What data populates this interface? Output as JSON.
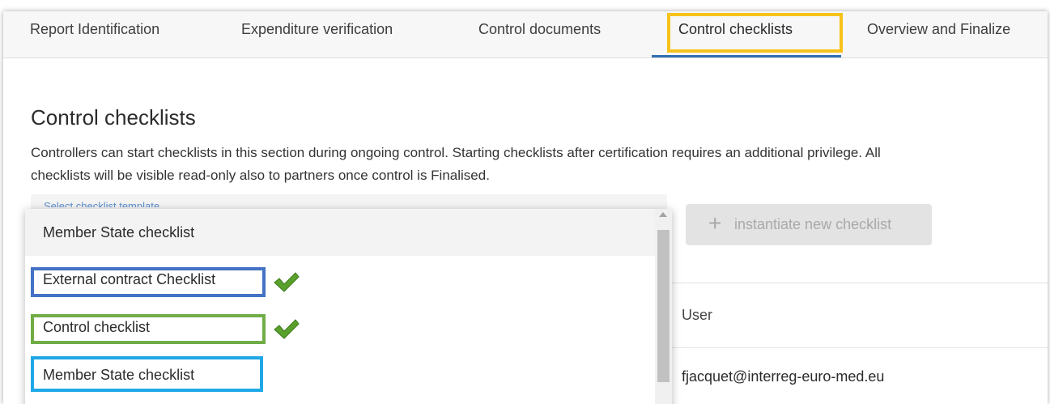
{
  "tabs": [
    {
      "label": "Report Identification"
    },
    {
      "label": "Expenditure verification"
    },
    {
      "label": "Control documents"
    },
    {
      "label": "Control checklists"
    },
    {
      "label": "Overview and Finalize"
    }
  ],
  "section": {
    "title": "Control checklists",
    "description": "Controllers can start checklists in this section during ongoing control. Starting checklists after certification requires an additional privilege. All checklists will be visible read-only also to partners once control is Finalised."
  },
  "select": {
    "placeholder": "Select checklist template"
  },
  "dropdown": {
    "options": [
      {
        "label": "Member State checklist"
      },
      {
        "label": "External contract Checklist"
      },
      {
        "label": "Control checklist"
      },
      {
        "label": "Member State checklist"
      }
    ]
  },
  "instantiate_button": {
    "icon": "+",
    "label": "instantiate new checklist"
  },
  "table": {
    "columns": [
      "User"
    ],
    "rows": [
      {
        "user": "fjacquet@interreg-euro-med.eu"
      }
    ]
  },
  "colors": {
    "active_tab_underline": "#2f6fb0",
    "highlight_yellow": "#f7c21a",
    "highlight_dark_blue": "#4472c4",
    "highlight_green": "#70ad47",
    "highlight_cyan": "#1fa8e6",
    "checkmark_green": "#5aa02c"
  },
  "icons": [
    "plus-icon",
    "checkmark-icon",
    "scroll-up-arrow-icon"
  ]
}
